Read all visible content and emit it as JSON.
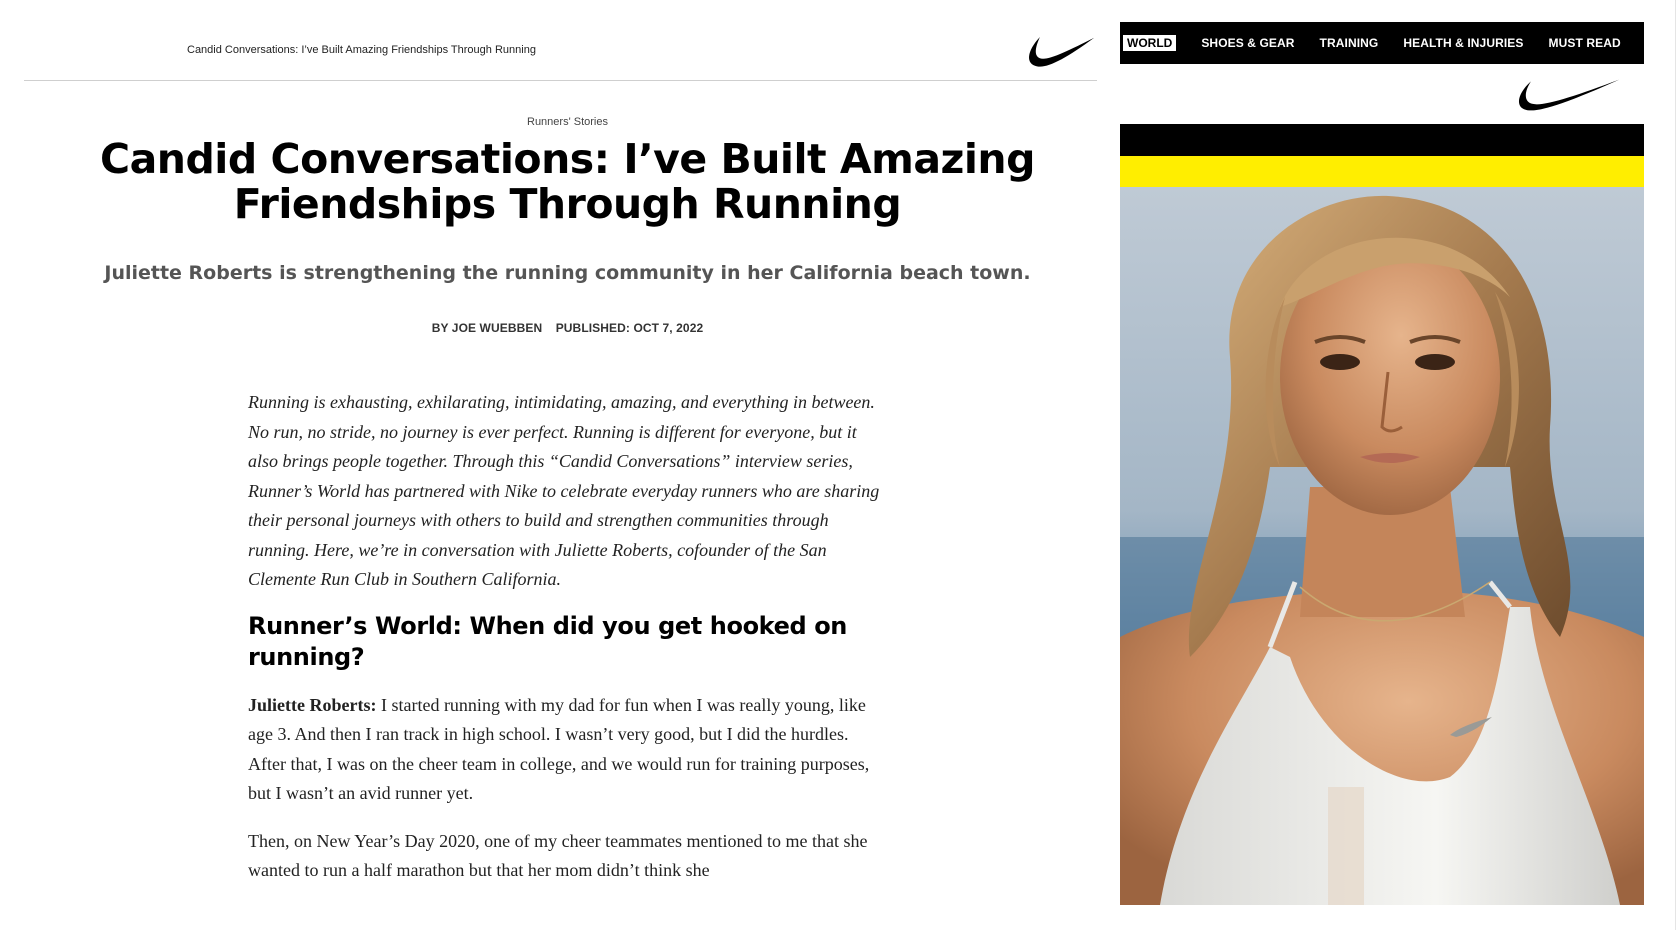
{
  "article": {
    "top_title": "Candid Conversations: I’ve Built Amazing Friendships Through Running",
    "category": "Runners' Stories",
    "headline": "Candid Conversations: I’ve Built Amazing Friendships Through Running",
    "dek": "Juliette Roberts is strengthening the running community in her California beach town.",
    "byline": "BY JOE WUEBBEN",
    "published": "PUBLISHED: OCT 7, 2022",
    "intro": "Running is exhausting, exhilarating, intimidating, amazing, and everything in between. No run, no stride, no journey is ever perfect. Running is different for everyone, but it also brings people together. Through this “Candid Conversations” interview series, Runner’s World has partnered with Nike to celebrate everyday runners who are sharing their personal journeys with others to build and strengthen communities through running. Here, we’re in conversation with Juliette Roberts, cofounder of the San Clemente Run Club in Southern California.",
    "question": "Runner’s World: When did you get hooked on running?",
    "answer_speaker": "Juliette Roberts:",
    "answer_text": " I started running with my dad for fun when I was really young, like age 3. And then I ran track in high school. I wasn’t very good, but I did the hurdles. After that, I was on the cheer team in college, and we would run for training purposes, but I wasn’t an avid runner yet.",
    "paragraph2": "Then, on New Year’s Day 2020, one of my cheer teammates mentioned to me that she wanted to run a half marathon but that her mom didn’t think she"
  },
  "side": {
    "nav_brand": "WORLD",
    "nav_items": [
      "SHOES & GEAR",
      "TRAINING",
      "HEALTH & INJURIES",
      "MUST READ"
    ],
    "colors": {
      "nav_bg": "#000000",
      "stripe_black": "#000000",
      "stripe_yellow": "#ffee00"
    }
  },
  "icons": {
    "logo": "nike-swoosh-icon"
  }
}
